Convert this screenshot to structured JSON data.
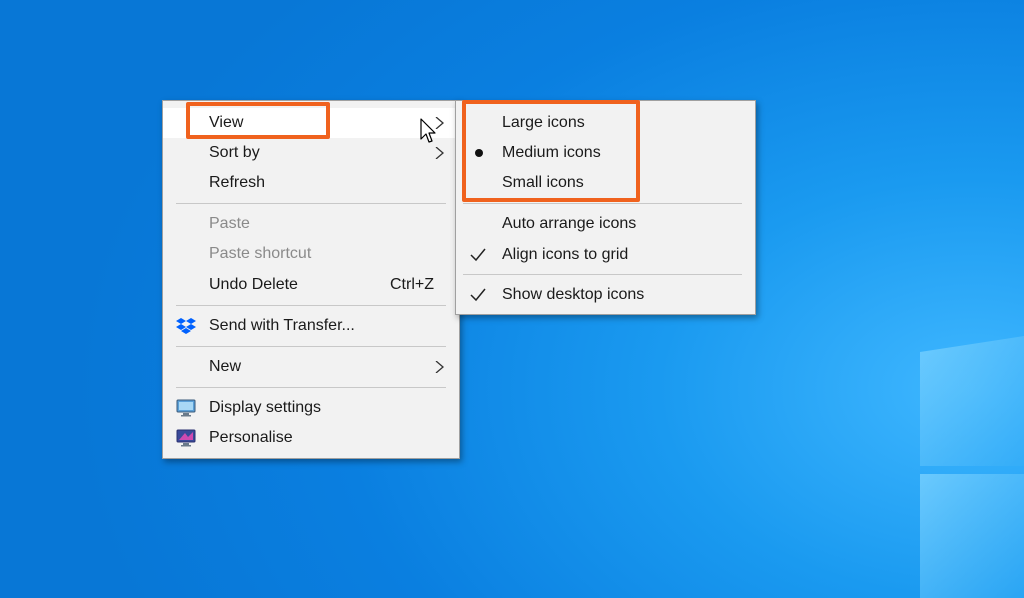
{
  "context_menu": {
    "items": [
      {
        "label": "View",
        "has_submenu": true,
        "highlighted": true
      },
      {
        "label": "Sort by",
        "has_submenu": true
      },
      {
        "label": "Refresh"
      },
      {
        "label": "Paste",
        "disabled": true
      },
      {
        "label": "Paste shortcut",
        "disabled": true
      },
      {
        "label": "Undo Delete",
        "shortcut": "Ctrl+Z"
      },
      {
        "label": "Send with Transfer...",
        "icon": "dropbox-icon"
      },
      {
        "label": "New",
        "has_submenu": true
      },
      {
        "label": "Display settings",
        "icon": "display-settings-icon"
      },
      {
        "label": "Personalise",
        "icon": "personalise-icon"
      }
    ]
  },
  "view_submenu": {
    "items": [
      {
        "label": "Large icons"
      },
      {
        "label": "Medium icons",
        "selected": true
      },
      {
        "label": "Small icons"
      },
      {
        "label": "Auto arrange icons",
        "checked": false
      },
      {
        "label": "Align icons to grid",
        "checked": true
      },
      {
        "label": "Show desktop icons",
        "checked": true
      }
    ]
  },
  "colors": {
    "desktop": "#0a7fe0",
    "menu_bg": "#f2f2f2",
    "annotation": "#f0621e"
  }
}
